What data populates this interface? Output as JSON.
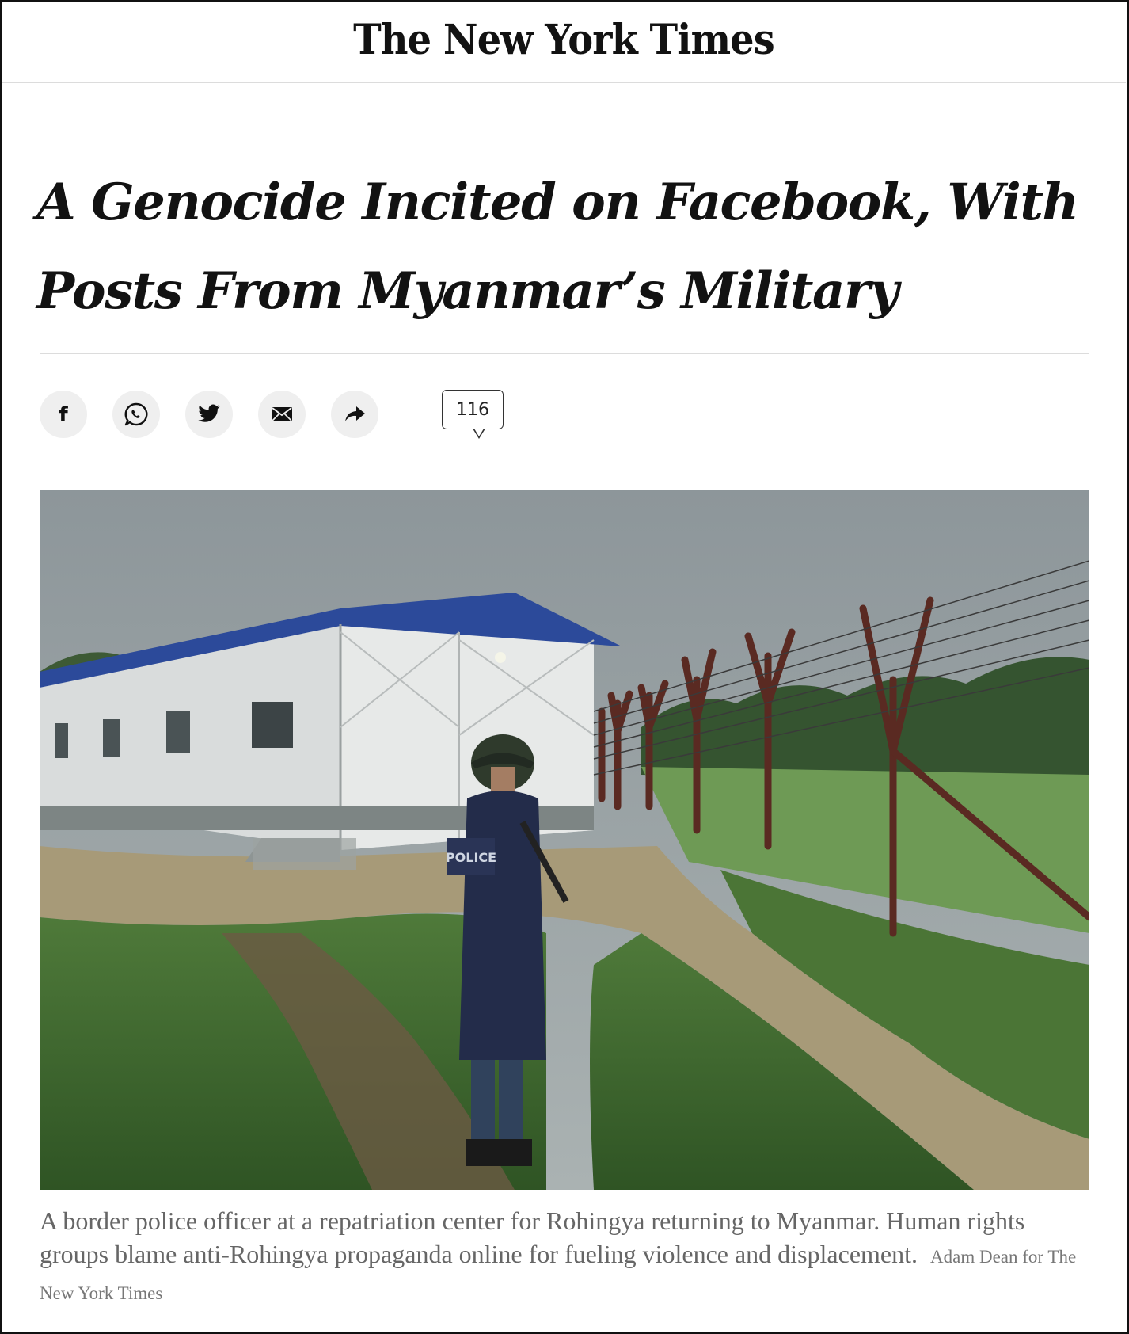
{
  "masthead": {
    "logo_text": "The New York Times"
  },
  "article": {
    "headline": "A Genocide Incited on Facebook, With Posts From Myanmar’s Military",
    "comment_count": "116",
    "photo": {
      "caption": "A border police officer at a repatriation center for Rohingya returning to Myanmar. Human rights groups blame anti-Rohingya propaganda online for fueling violence and displacement.",
      "credit": "Adam Dean for The New York Times",
      "vest_text": "POLICE"
    }
  },
  "share_bar": {
    "buttons": [
      {
        "icon": "facebook-icon"
      },
      {
        "icon": "whatsapp-icon"
      },
      {
        "icon": "twitter-icon"
      },
      {
        "icon": "email-icon"
      },
      {
        "icon": "share-arrow-icon"
      }
    ]
  },
  "colors": {
    "text_primary": "#121212",
    "caption_text": "#666666",
    "share_button_bg": "#efefef",
    "divider": "#dcdcdc"
  }
}
